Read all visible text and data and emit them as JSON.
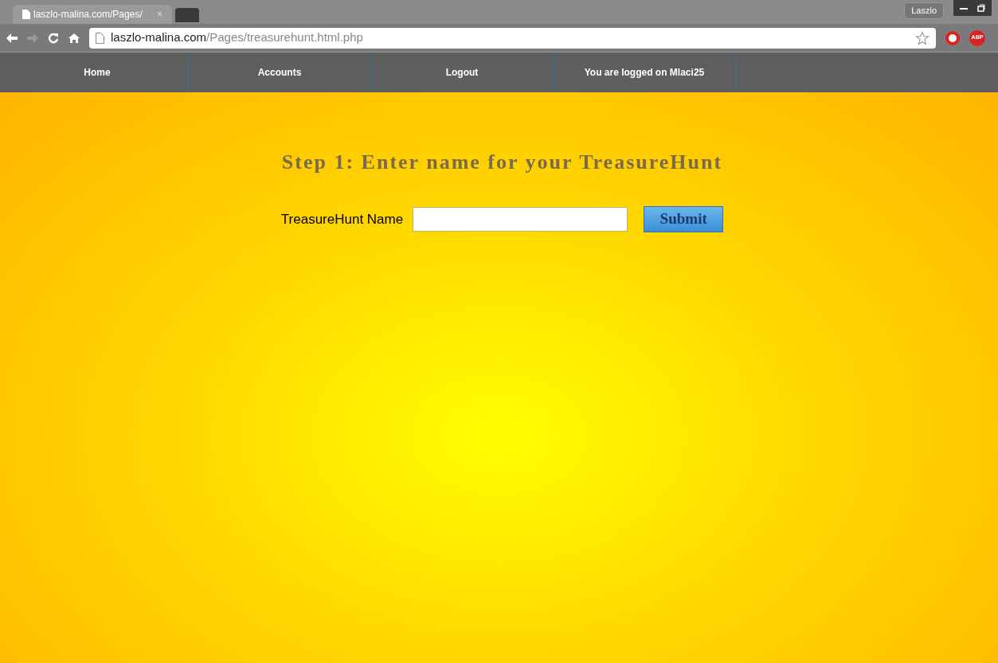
{
  "browser": {
    "tab": {
      "title": "laszlo-malina.com/Pages/",
      "close": "×"
    },
    "profile": "Laszlo",
    "url": {
      "host": "laszlo-malina.com",
      "path": "/Pages/treasurehunt.html.php"
    },
    "extension_badge": "ABP"
  },
  "nav": {
    "items": [
      {
        "label": "Home"
      },
      {
        "label": "Accounts"
      },
      {
        "label": "Logout"
      },
      {
        "label": "You are logged on Mlaci25"
      }
    ]
  },
  "heading": "Step 1: Enter name for your TreasureHunt",
  "form": {
    "label": "TreasureHunt Name",
    "button": "Submit"
  }
}
